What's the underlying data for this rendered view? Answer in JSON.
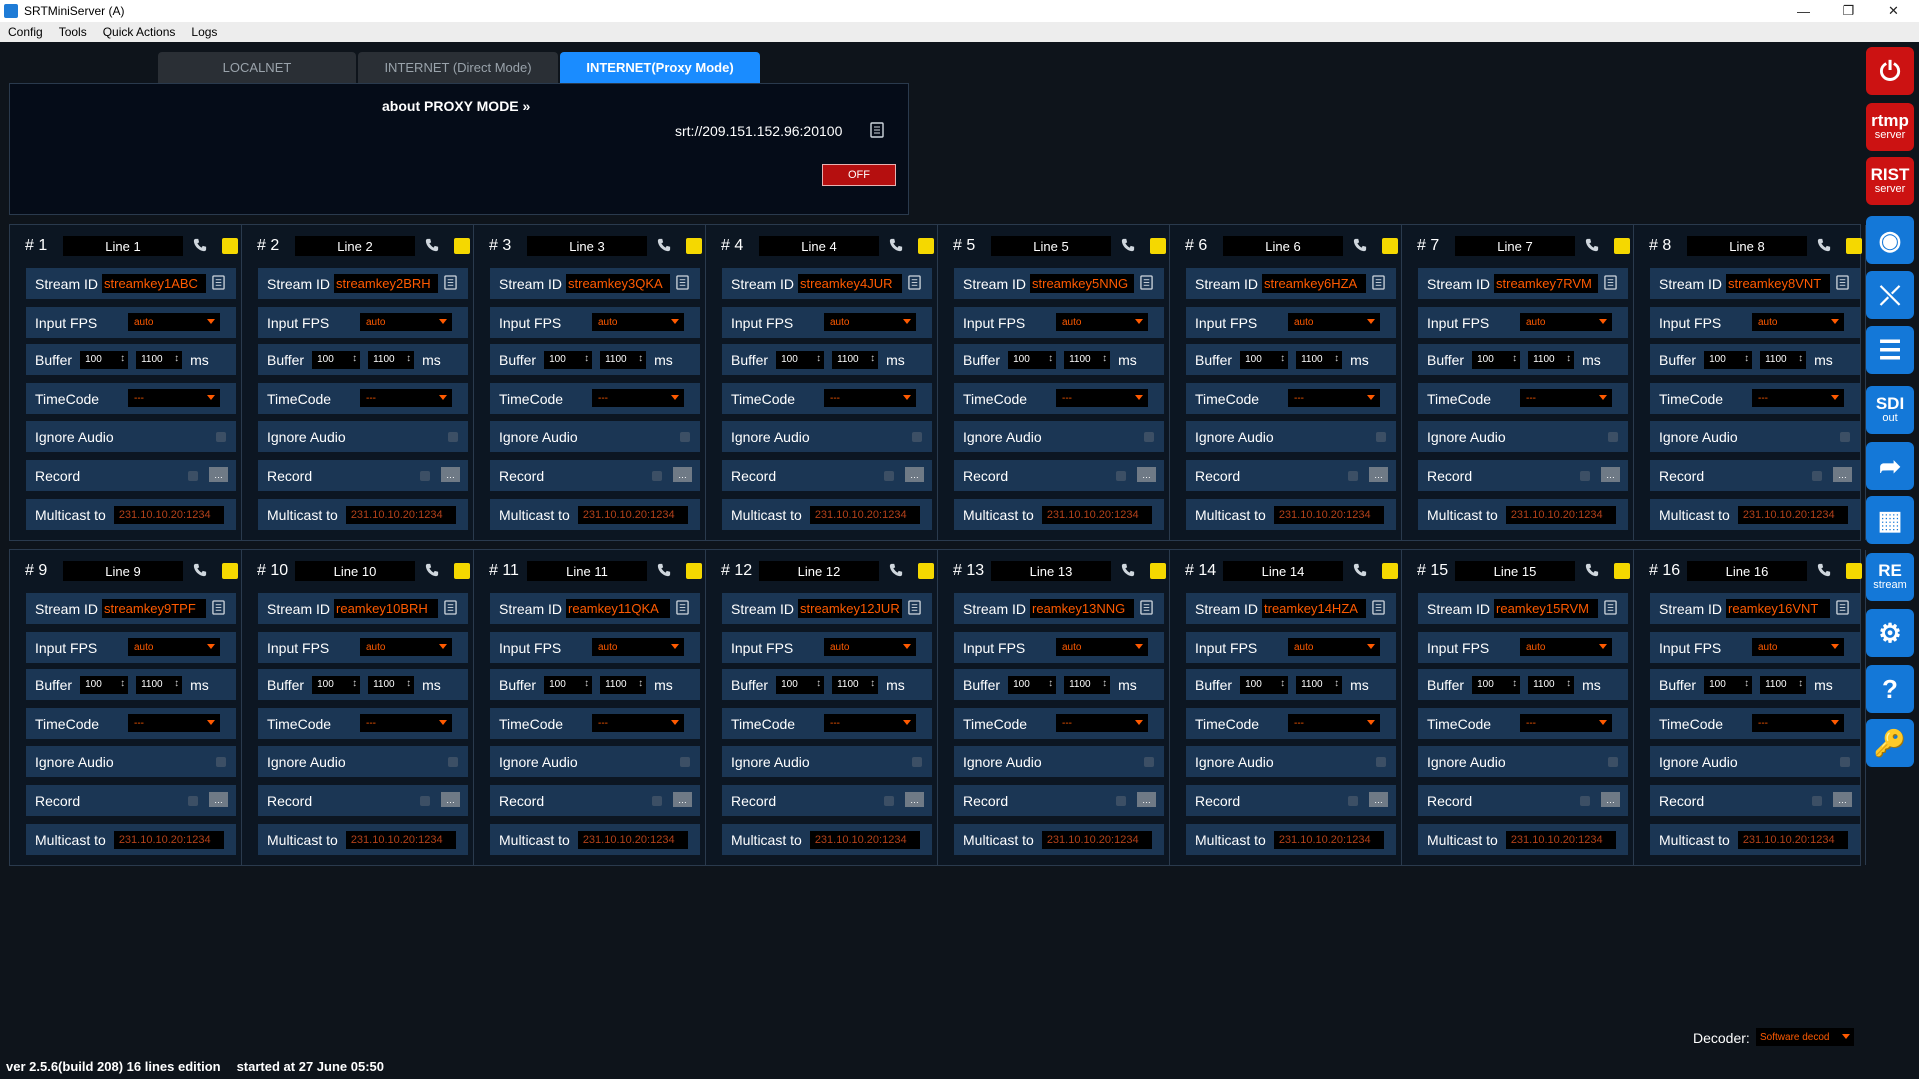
{
  "window": {
    "title": "SRTMiniServer (A)"
  },
  "menu": [
    "Config",
    "Tools",
    "Quick Actions",
    "Logs"
  ],
  "tabs": [
    {
      "label": "LOCALNET",
      "active": false
    },
    {
      "label": "INTERNET (Direct Mode)",
      "active": false
    },
    {
      "label": "INTERNET(Proxy Mode)",
      "active": true
    }
  ],
  "proxy": {
    "about": "about PROXY MODE »",
    "url": "srt://209.151.152.96:20100",
    "toggle": "OFF"
  },
  "labels": {
    "stream_id": "Stream ID",
    "input_fps": "Input FPS",
    "buffer": "Buffer",
    "ms": "ms",
    "timecode": "TimeCode",
    "ignore_audio": "Ignore Audio",
    "record": "Record",
    "multicast": "Multicast to"
  },
  "lines": [
    {
      "num": "# 1",
      "name": "Line 1",
      "stream_id": "streamkey1ABC",
      "fps": "auto",
      "buf_min": "100",
      "buf_max": "1100",
      "timecode": "---",
      "multicast": "231.10.10.20:1234"
    },
    {
      "num": "# 2",
      "name": "Line 2",
      "stream_id": "streamkey2BRH",
      "fps": "auto",
      "buf_min": "100",
      "buf_max": "1100",
      "timecode": "---",
      "multicast": "231.10.10.20:1234"
    },
    {
      "num": "# 3",
      "name": "Line 3",
      "stream_id": "streamkey3QKA",
      "fps": "auto",
      "buf_min": "100",
      "buf_max": "1100",
      "timecode": "---",
      "multicast": "231.10.10.20:1234"
    },
    {
      "num": "# 4",
      "name": "Line 4",
      "stream_id": "streamkey4JUR",
      "fps": "auto",
      "buf_min": "100",
      "buf_max": "1100",
      "timecode": "---",
      "multicast": "231.10.10.20:1234"
    },
    {
      "num": "# 5",
      "name": "Line 5",
      "stream_id": "streamkey5NNG",
      "fps": "auto",
      "buf_min": "100",
      "buf_max": "1100",
      "timecode": "---",
      "multicast": "231.10.10.20:1234"
    },
    {
      "num": "# 6",
      "name": "Line 6",
      "stream_id": "streamkey6HZA",
      "fps": "auto",
      "buf_min": "100",
      "buf_max": "1100",
      "timecode": "---",
      "multicast": "231.10.10.20:1234"
    },
    {
      "num": "# 7",
      "name": "Line 7",
      "stream_id": "streamkey7RVM",
      "fps": "auto",
      "buf_min": "100",
      "buf_max": "1100",
      "timecode": "---",
      "multicast": "231.10.10.20:1234"
    },
    {
      "num": "# 8",
      "name": "Line 8",
      "stream_id": "streamkey8VNT",
      "fps": "auto",
      "buf_min": "100",
      "buf_max": "1100",
      "timecode": "---",
      "multicast": "231.10.10.20:1234"
    },
    {
      "num": "# 9",
      "name": "Line 9",
      "stream_id": "streamkey9TPF",
      "fps": "auto",
      "buf_min": "100",
      "buf_max": "1100",
      "timecode": "---",
      "multicast": "231.10.10.20:1234"
    },
    {
      "num": "# 10",
      "name": "Line 10",
      "stream_id": "reamkey10BRH",
      "fps": "auto",
      "buf_min": "100",
      "buf_max": "1100",
      "timecode": "---",
      "multicast": "231.10.10.20:1234"
    },
    {
      "num": "# 11",
      "name": "Line 11",
      "stream_id": "reamkey11QKA",
      "fps": "auto",
      "buf_min": "100",
      "buf_max": "1100",
      "timecode": "---",
      "multicast": "231.10.10.20:1234"
    },
    {
      "num": "# 12",
      "name": "Line 12",
      "stream_id": "streamkey12JUR",
      "fps": "auto",
      "buf_min": "100",
      "buf_max": "1100",
      "timecode": "---",
      "multicast": "231.10.10.20:1234"
    },
    {
      "num": "# 13",
      "name": "Line 13",
      "stream_id": "reamkey13NNG",
      "fps": "auto",
      "buf_min": "100",
      "buf_max": "1100",
      "timecode": "---",
      "multicast": "231.10.10.20:1234"
    },
    {
      "num": "# 14",
      "name": "Line 14",
      "stream_id": "treamkey14HZA",
      "fps": "auto",
      "buf_min": "100",
      "buf_max": "1100",
      "timecode": "---",
      "multicast": "231.10.10.20:1234"
    },
    {
      "num": "# 15",
      "name": "Line 15",
      "stream_id": "reamkey15RVM",
      "fps": "auto",
      "buf_min": "100",
      "buf_max": "1100",
      "timecode": "---",
      "multicast": "231.10.10.20:1234"
    },
    {
      "num": "# 16",
      "name": "Line 16",
      "stream_id": "reamkey16VNT",
      "fps": "auto",
      "buf_min": "100",
      "buf_max": "1100",
      "timecode": "---",
      "multicast": "231.10.10.20:1234"
    }
  ],
  "sidebar": [
    {
      "icon": "power-icon",
      "t1": "",
      "t2": "",
      "color": "#cc1212"
    },
    {
      "icon": "rtmp-server-icon",
      "t1": "rtmp",
      "t2": "server",
      "color": "#cc1212"
    },
    {
      "icon": "rist-server-icon",
      "t1": "RIST",
      "t2": "server",
      "color": "#cc1212"
    },
    {
      "icon": "image-eye-icon",
      "t1": "",
      "t2": "",
      "color": "#1478d8"
    },
    {
      "icon": "crossover-icon",
      "t1": "",
      "t2": "",
      "color": "#1478d8"
    },
    {
      "icon": "schedule-list-icon",
      "t1": "",
      "t2": "",
      "color": "#1478d8"
    },
    {
      "icon": "sdi-out-icon",
      "t1": "SDI",
      "t2": "out",
      "color": "#1478d8"
    },
    {
      "icon": "share-icon",
      "t1": "",
      "t2": "",
      "color": "#1478d8"
    },
    {
      "icon": "layout-grid-icon",
      "t1": "",
      "t2": "",
      "color": "#1478d8"
    },
    {
      "icon": "restream-icon",
      "t1": "RE",
      "t2": "stream",
      "color": "#1478d8"
    },
    {
      "icon": "gear-icon",
      "t1": "",
      "t2": "",
      "color": "#1478d8"
    },
    {
      "icon": "help-icon",
      "t1": "",
      "t2": "",
      "color": "#1478d8"
    },
    {
      "icon": "key-icon",
      "t1": "",
      "t2": "",
      "color": "#1478d8"
    }
  ],
  "decoder": {
    "label": "Decoder:",
    "value": "Software decod"
  },
  "status": {
    "version": "ver 2.5.6(build 208) 16 lines edition",
    "started": "started at 27 June 05:50"
  }
}
